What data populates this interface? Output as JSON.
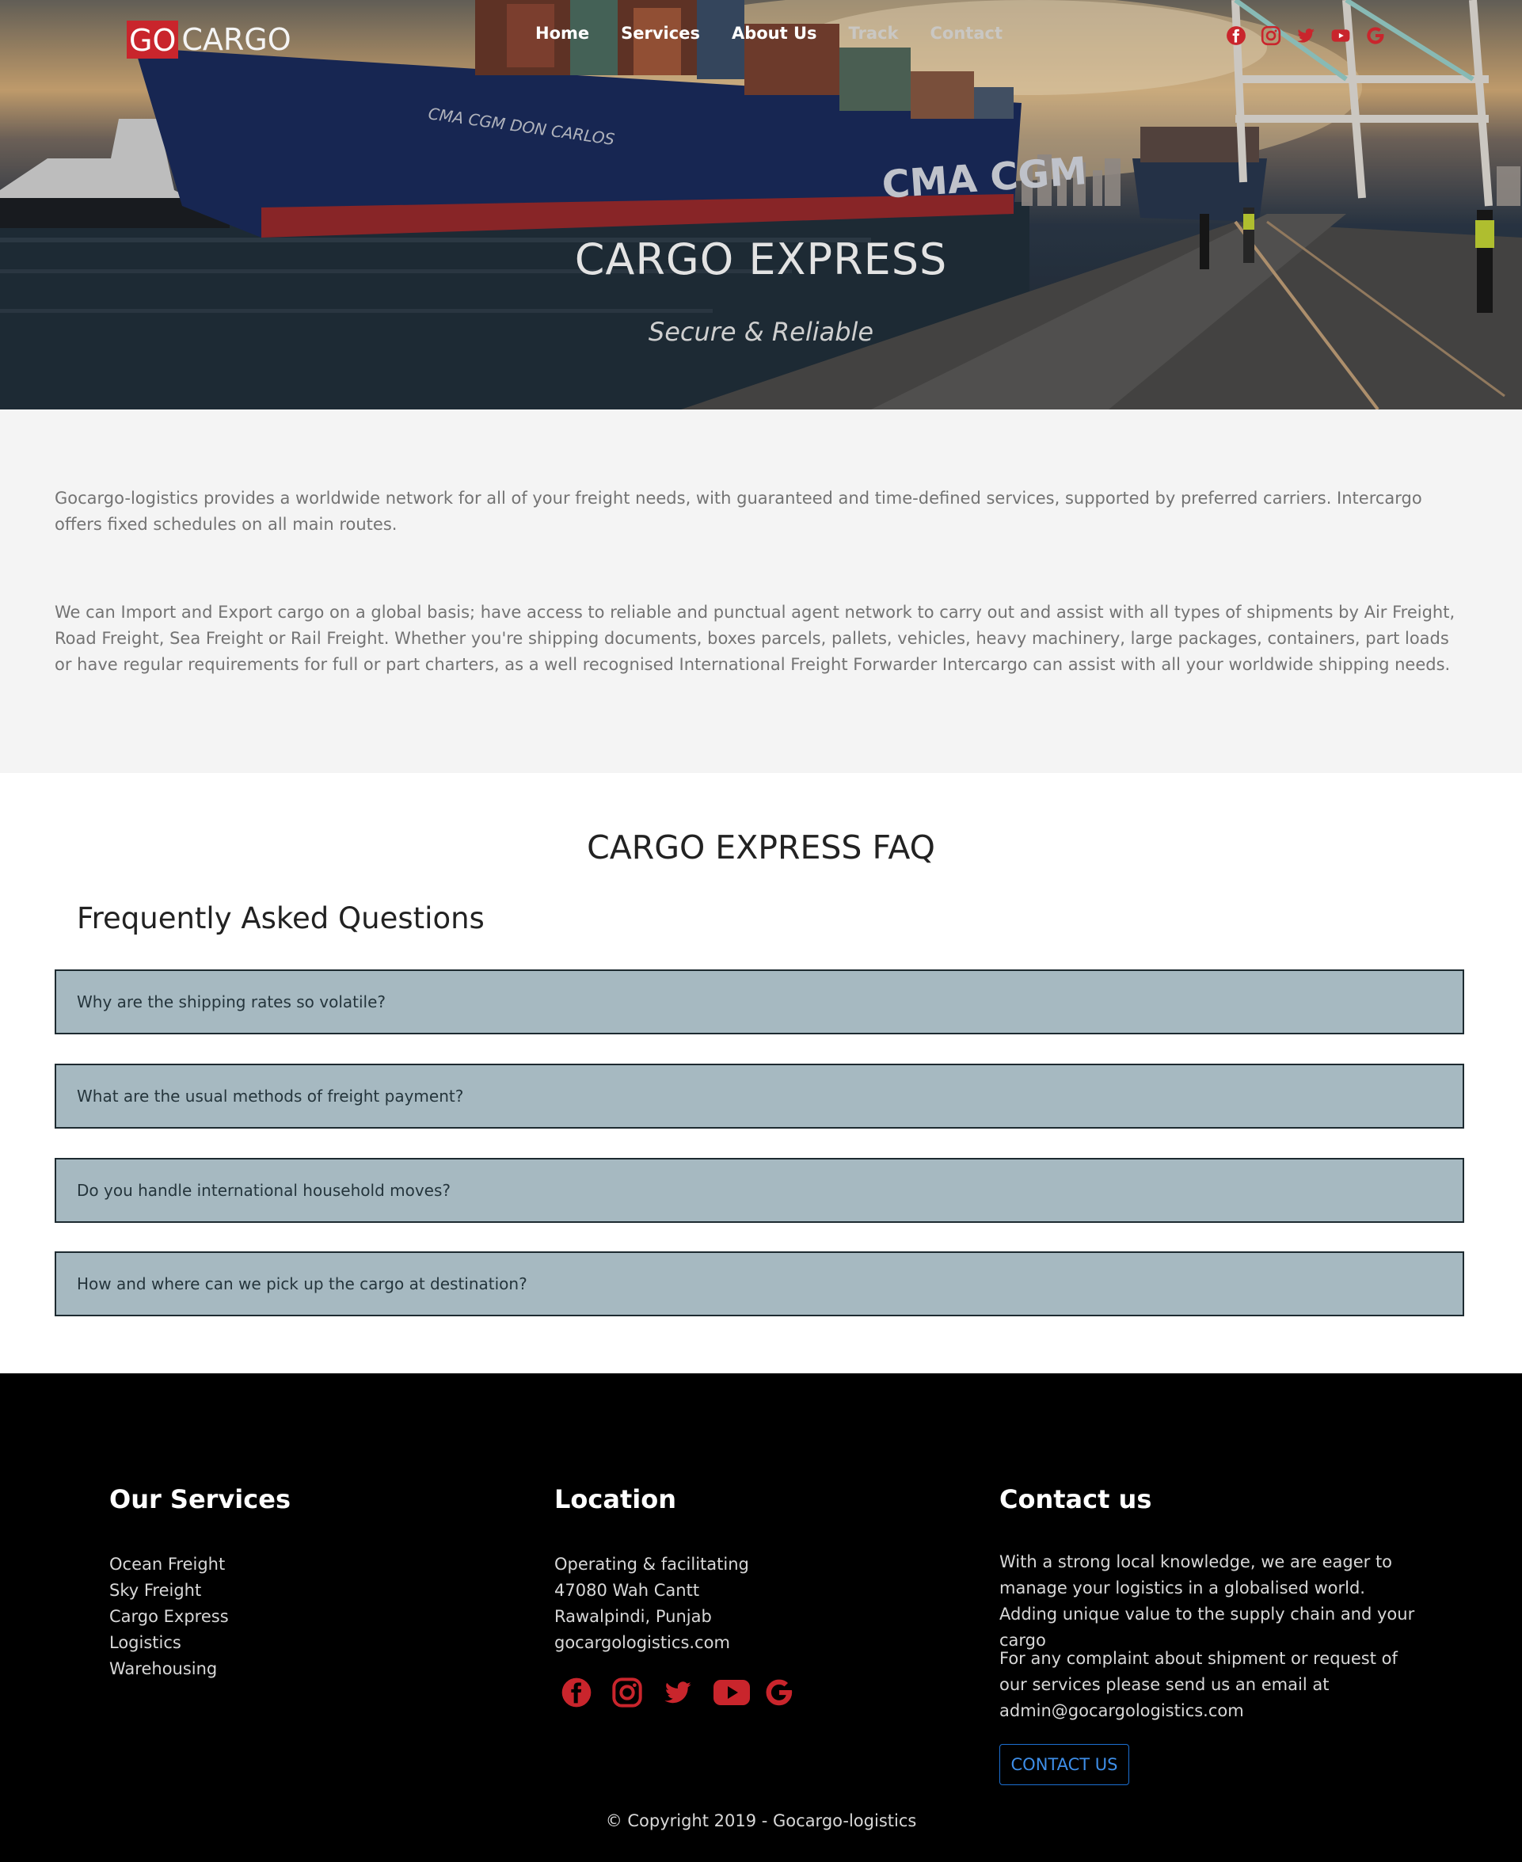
{
  "brand": {
    "logo_go": "GO",
    "logo_cargo": "CARGO"
  },
  "nav": {
    "items": [
      {
        "label": "Home"
      },
      {
        "label": "Services"
      },
      {
        "label": "About Us"
      },
      {
        "label": "Track"
      },
      {
        "label": "Contact"
      }
    ],
    "social_icons": [
      "facebook-icon",
      "instagram-icon",
      "twitter-icon",
      "youtube-icon",
      "google-icon"
    ]
  },
  "hero": {
    "title": "CARGO EXPRESS",
    "subtitle": "Secure & Reliable",
    "ship_name": "CMA CGM DON CARLOS",
    "hull_text": "CMA CGM",
    "accent_color": "#c9252c"
  },
  "about": {
    "paragraph_1": "Gocargo-logistics provides a worldwide network for all of your freight needs, with guaranteed and time-defined services, supported by preferred carriers. Intercargo offers fixed schedules on all main routes.",
    "paragraph_2": "We can Import and Export cargo on a global basis; have access to reliable and punctual agent network to carry out and assist with all types of shipments by Air Freight, Road Freight, Sea Freight or Rail Freight. Whether you're shipping documents, boxes parcels, pallets, vehicles, heavy machinery, large packages, containers, part loads or have regular requirements for full or part charters, as a well recognised International Freight Forwarder Intercargo can assist with all your worldwide shipping needs."
  },
  "faq": {
    "title": "CARGO EXPRESS FAQ",
    "subtitle": "Frequently Asked Questions",
    "questions": [
      {
        "q": "Why are the shipping rates so volatile?"
      },
      {
        "q": "What are the usual methods of freight payment?"
      },
      {
        "q": "Do you handle international household moves?"
      },
      {
        "q": "How and where can we pick up the cargo at destination?"
      }
    ]
  },
  "footer": {
    "services": {
      "heading": "Our Services",
      "items": [
        "Ocean Freight",
        "Sky Freight",
        "Cargo Express",
        "Logistics",
        "Warehousing"
      ]
    },
    "location": {
      "heading": "Location",
      "lines": [
        "Operating & facilitating",
        "47080 Wah Cantt",
        "Rawalpindi, Punjab",
        "gocargologistics.com"
      ],
      "social_icons": [
        "facebook-icon",
        "instagram-icon",
        "twitter-icon",
        "youtube-icon",
        "google-icon"
      ]
    },
    "contact": {
      "heading": "Contact us",
      "paragraph_1": "With a strong local knowledge, we are eager to manage your logistics in a globalised world. Adding unique value to the supply chain and your cargo",
      "paragraph_2": "For any complaint about shipment or request of our services please send us an email at admin@gocargologistics.com",
      "button_label": "CONTACT US"
    },
    "copyright": "© Copyright 2019 - Gocargo-logistics"
  }
}
